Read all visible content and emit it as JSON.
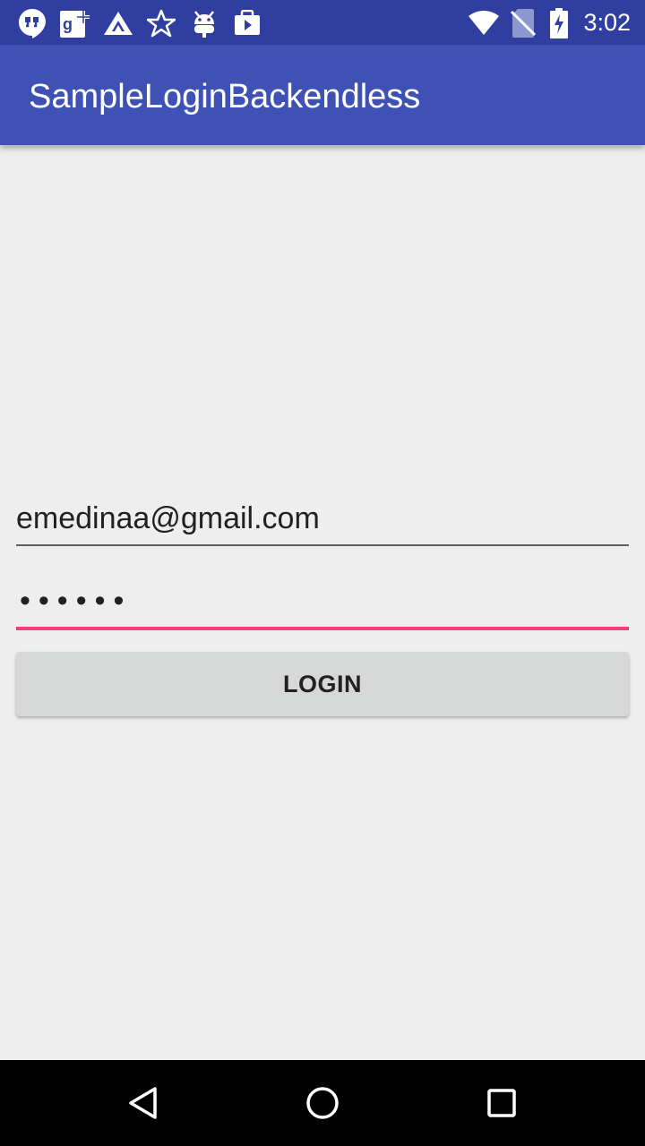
{
  "status_bar": {
    "time": "3:02",
    "notification_icons": [
      "hangouts-icon",
      "google-plus-icon",
      "app-icon",
      "star-icon",
      "android-icon",
      "play-store-icon"
    ],
    "system_icons": [
      "wifi-icon",
      "no-sim-icon",
      "battery-charging-icon"
    ]
  },
  "app_bar": {
    "title": "SampleLoginBackendless",
    "color": "#3F51B5"
  },
  "form": {
    "email_value": "emedinaa@gmail.com",
    "password_mask": "••••••",
    "login_label": "LOGIN",
    "accent_color": "#EC407A"
  },
  "nav_bar": {
    "icons": [
      "back-icon",
      "home-icon",
      "recents-icon"
    ]
  }
}
